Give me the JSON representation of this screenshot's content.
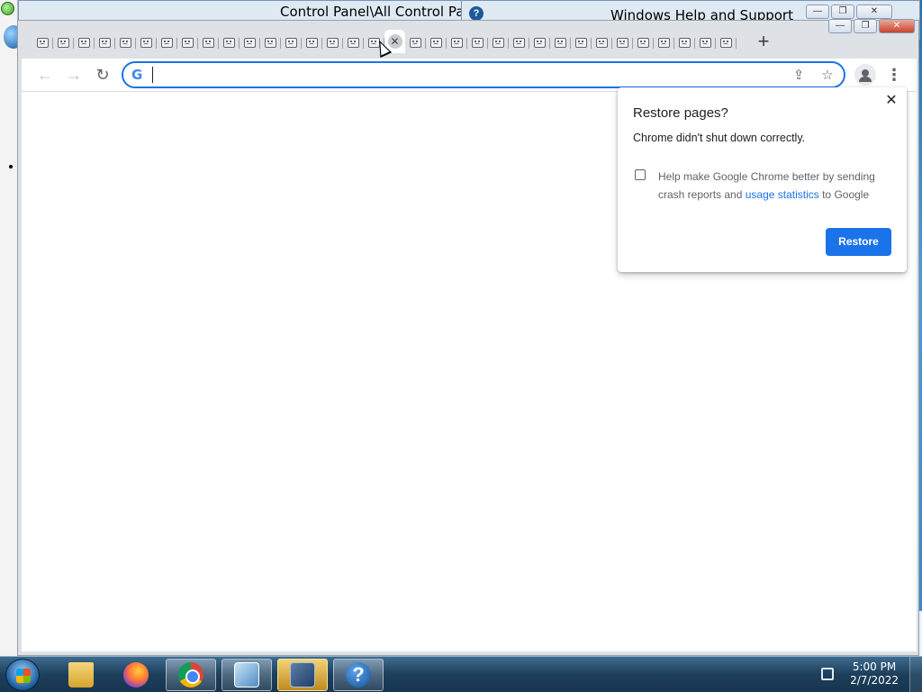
{
  "background_windows": {
    "control_panel_title": "Control Panel\\All Control Panel",
    "help_title": "Windows Help and Support",
    "min_glyph": "—",
    "max_glyph": "❐",
    "close_glyph": "✕"
  },
  "chrome": {
    "tab_count": 34,
    "active_tab_index": 17,
    "new_tab_label": "+",
    "toolbar": {
      "back_glyph": "←",
      "forward_glyph": "→",
      "reload_glyph": "↻",
      "omnibox_value": "",
      "share_glyph": "⇪",
      "bookmark_glyph": "☆",
      "menu_glyph": "⋮"
    },
    "restore_popup": {
      "title": "Restore pages?",
      "message": "Chrome didn't shut down correctly.",
      "help_text_before": "Help make Google Chrome better by sending crash reports and ",
      "help_link": "usage statistics",
      "help_text_after": " to Google",
      "checkbox_checked": false,
      "restore_label": "Restore",
      "close_glyph": "✕"
    }
  },
  "taskbar": {
    "apps": [
      {
        "name": "windows-explorer",
        "icon": "folder-icon"
      },
      {
        "name": "firefox",
        "icon": "firefox-icon"
      },
      {
        "name": "chrome",
        "icon": "chrome-icon"
      },
      {
        "name": "control-panel",
        "icon": "control-panel-icon"
      },
      {
        "name": "remote-desktop",
        "icon": "remote-desktop-icon"
      },
      {
        "name": "help-and-support",
        "icon": "help-icon"
      }
    ],
    "help_glyph": "?",
    "time": "5:00 PM",
    "date": "2/7/2022"
  },
  "colors": {
    "accent_blue": "#1a73e8",
    "tabstrip_bg": "#dee1e6",
    "taskbar_bg": "#1c3f5c"
  }
}
